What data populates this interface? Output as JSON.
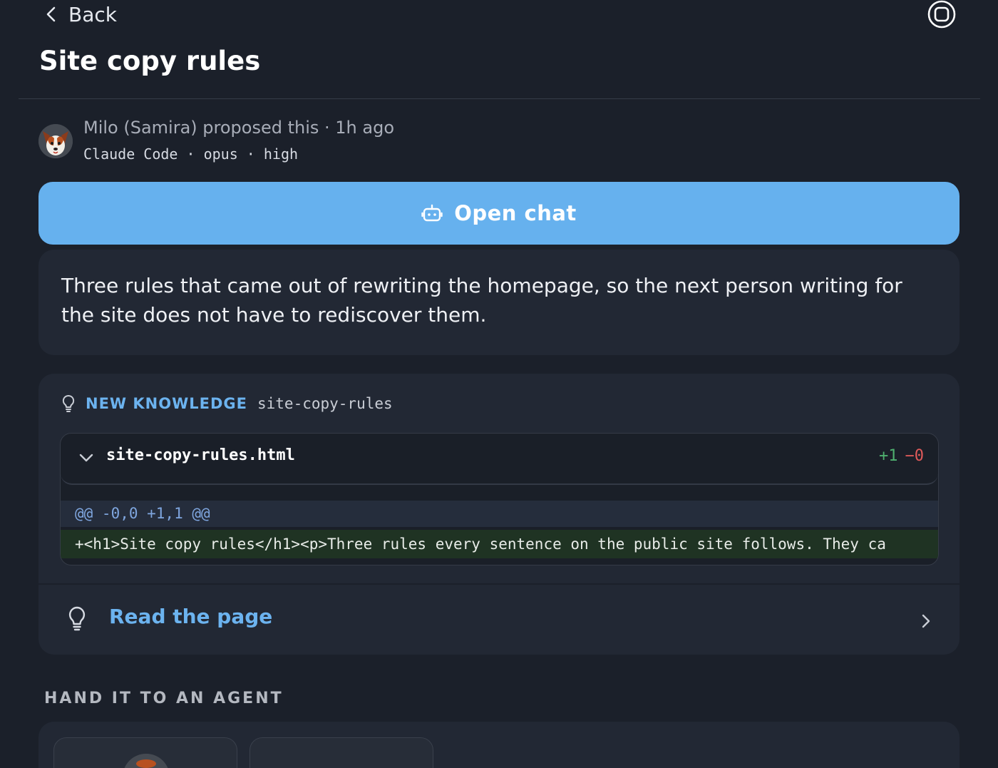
{
  "header": {
    "back_label": "Back",
    "title": "Site copy rules"
  },
  "proposal": {
    "proposer_text": "Milo (Samira) proposed this · 1h ago",
    "meta_text": "Claude Code · opus · high"
  },
  "open_chat": {
    "label": "Open chat"
  },
  "description": {
    "text": "Three rules that came out of rewriting the homepage, so the next person writing for the site does not have to rediscover them."
  },
  "knowledge": {
    "tag": "NEW KNOWLEDGE",
    "slug": "site-copy-rules",
    "file": {
      "name": "site-copy-rules.html",
      "additions": "+1",
      "deletions": "−0"
    },
    "hunk_header": "@@ -0,0 +1,1 @@",
    "added_line": "+<h1>Site copy rules</h1><p>Three rules every sentence on the public site follows. They ca",
    "read_label": "Read the page"
  },
  "handoff": {
    "section_label": "HAND IT TO AN AGENT"
  },
  "colors": {
    "background": "#1b202a",
    "card": "#222834",
    "accent": "#66b1ee",
    "link": "#6cb3ef",
    "diff_add": "#4fb06f",
    "diff_del": "#e05a5a"
  }
}
